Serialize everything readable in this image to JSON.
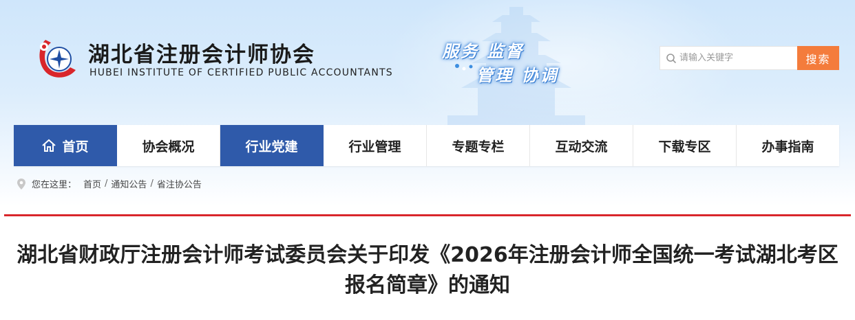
{
  "header": {
    "title": "湖北省注册会计师协会",
    "subtitle": "HUBEI INSTITUTE OF CERTIFIED PUBLIC ACCOUNTANTS",
    "slogan_line1": "服务 监督",
    "slogan_line2": "管理 协调"
  },
  "search": {
    "placeholder": "请输入关键字",
    "button_label": "搜索"
  },
  "nav": {
    "items": [
      {
        "label": "首页"
      },
      {
        "label": "协会概况"
      },
      {
        "label": "行业党建"
      },
      {
        "label": "行业管理"
      },
      {
        "label": "专题专栏"
      },
      {
        "label": "互动交流"
      },
      {
        "label": "下载专区"
      },
      {
        "label": "办事指南"
      }
    ]
  },
  "breadcrumb": {
    "prefix": "您在这里：",
    "items": [
      "首页",
      "通知公告",
      "省注协公告"
    ],
    "separator": "/"
  },
  "article": {
    "title": "湖北省财政厅注册会计师考试委员会关于印发《2026年注册会计师全国统一考试湖北考区报名简章》的通知"
  },
  "colors": {
    "nav_active": "#2f5aaa",
    "search_button": "#f47c3c",
    "divider": "#d9262b",
    "logo_red": "#d9262b",
    "logo_blue": "#1f4ea3"
  }
}
